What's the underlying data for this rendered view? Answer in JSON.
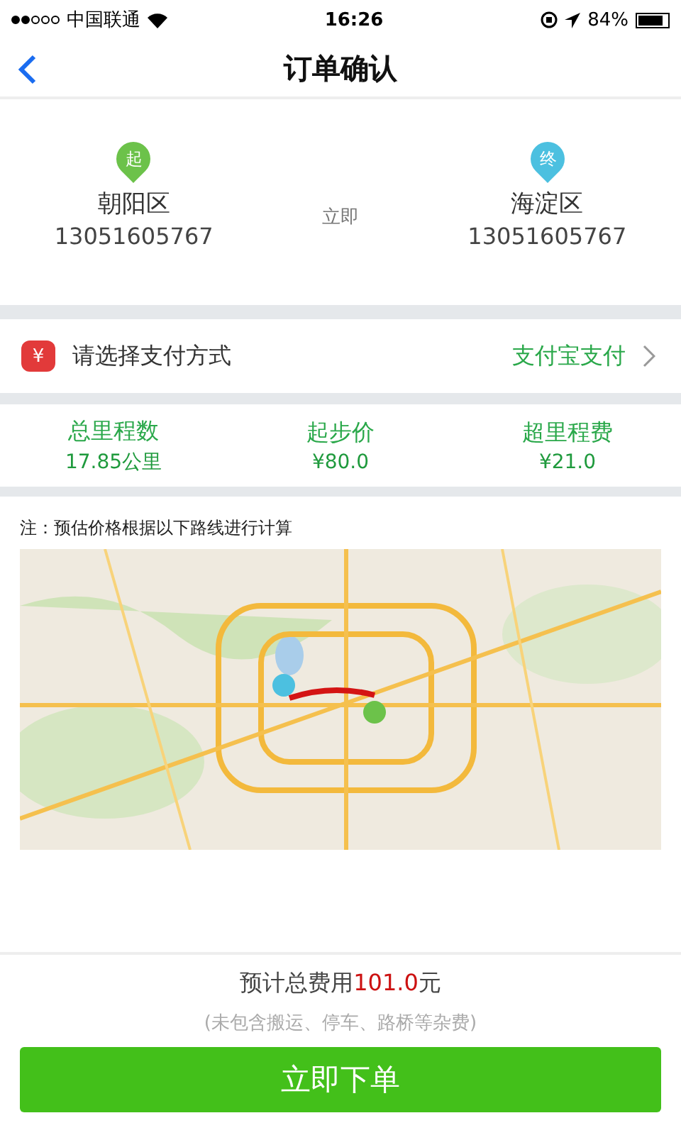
{
  "status_bar": {
    "carrier": "中国联通",
    "time": "16:26",
    "battery": "84%"
  },
  "nav": {
    "title": "订单确认"
  },
  "route": {
    "start": {
      "pin": "起",
      "place": "朝阳区",
      "phone": "13051605767"
    },
    "timing": "立即",
    "end": {
      "pin": "终",
      "place": "海淀区",
      "phone": "13051605767"
    }
  },
  "payment": {
    "icon": "¥",
    "label": "请选择支付方式",
    "value": "支付宝支付"
  },
  "stats": [
    {
      "label": "总里程数",
      "value": "17.85公里"
    },
    {
      "label": "起步价",
      "value": "¥80.0"
    },
    {
      "label": "超里程费",
      "value": "¥21.0"
    }
  ],
  "note": "注：预估价格根据以下路线进行计算",
  "total": {
    "prefix": "预计总费用",
    "amount": "101.0",
    "suffix": "元"
  },
  "disclaimer": "(未包含搬运、停车、路桥等杂费)",
  "submit": "立即下单"
}
